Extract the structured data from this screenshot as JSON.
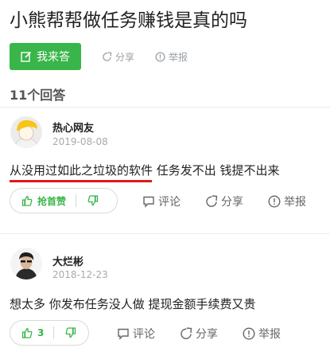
{
  "question": {
    "title": "小熊帮帮做任务赚钱是真的吗",
    "answer_button": "我来答",
    "share_label": "分享",
    "report_label": "举报"
  },
  "answers_header": "11个回答",
  "answers": [
    {
      "user": "热心网友",
      "date": "2019-08-08",
      "content": "从没用过如此之垃圾的软件 任务发不出 钱提不出来",
      "upvote_label": "抢首赞",
      "actions": {
        "comment": "评论",
        "share": "分享",
        "report": "举报"
      }
    },
    {
      "user": "大烂彬",
      "date": "2018-12-23",
      "content": "想太多 你发布任务没人做 提现金额手续费又贵",
      "upvote_label": "3",
      "actions": {
        "comment": "评论",
        "share": "分享",
        "report": "举报"
      }
    }
  ],
  "colors": {
    "accent_green": "#39b54a",
    "highlight_red": "#e01818"
  }
}
